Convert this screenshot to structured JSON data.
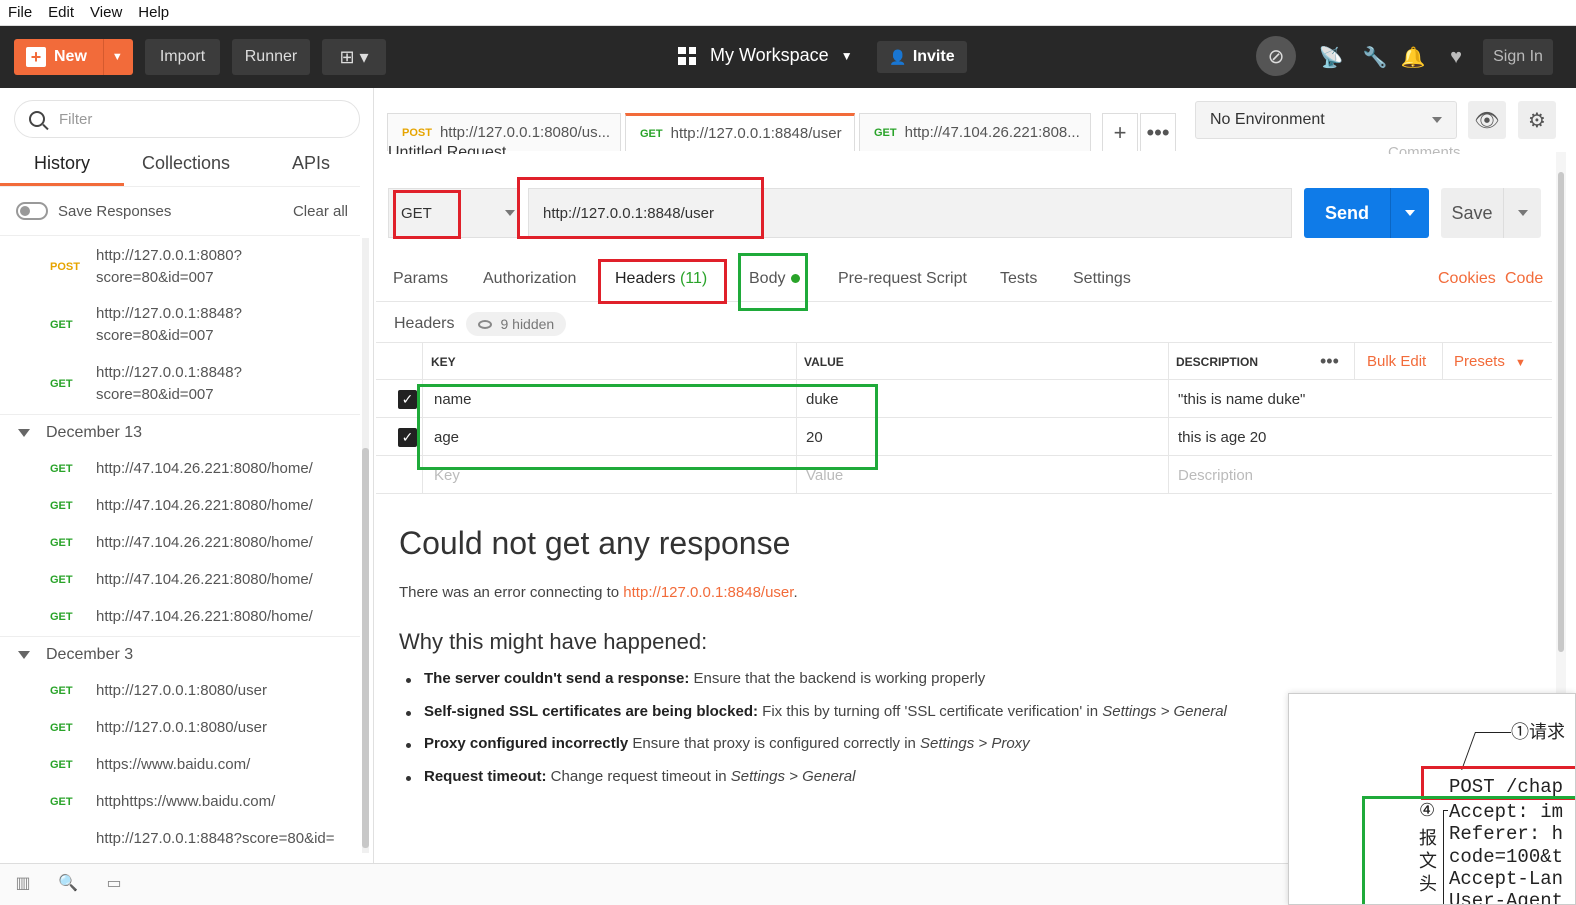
{
  "menu": [
    "File",
    "Edit",
    "View",
    "Help"
  ],
  "toolbar": {
    "new_label": "New",
    "import_label": "Import",
    "runner_label": "Runner",
    "workspace_label": "My Workspace",
    "invite_label": "Invite",
    "signin_label": "Sign In"
  },
  "sidebar": {
    "filter_placeholder": "Filter",
    "tabs": [
      "History",
      "Collections",
      "APIs"
    ],
    "save_responses": "Save Responses",
    "clear_all": "Clear all",
    "items_top": [
      {
        "method": "POST",
        "url": "http://127.0.0.1:8080?score=80&id=007"
      },
      {
        "method": "GET",
        "url": "http://127.0.0.1:8848?score=80&id=007"
      },
      {
        "method": "GET",
        "url": "http://127.0.0.1:8848?score=80&id=007"
      }
    ],
    "group1": "December 13",
    "items_g1": [
      {
        "method": "GET",
        "url": "http://47.104.26.221:8080/home/"
      },
      {
        "method": "GET",
        "url": "http://47.104.26.221:8080/home/"
      },
      {
        "method": "GET",
        "url": "http://47.104.26.221:8080/home/"
      },
      {
        "method": "GET",
        "url": "http://47.104.26.221:8080/home/"
      },
      {
        "method": "GET",
        "url": "http://47.104.26.221:8080/home/"
      }
    ],
    "group2": "December 3",
    "items_g2": [
      {
        "method": "GET",
        "url": "http://127.0.0.1:8080/user"
      },
      {
        "method": "GET",
        "url": "http://127.0.0.1:8080/user"
      },
      {
        "method": "GET",
        "url": "https://www.baidu.com/"
      },
      {
        "method": "GET",
        "url": "httphttps://www.baidu.com/"
      }
    ],
    "item_last": "http://127.0.0.1:8848?score=80&id="
  },
  "tabs": [
    {
      "method": "POST",
      "label": "http://127.0.0.1:8080/us..."
    },
    {
      "method": "GET",
      "label": "http://127.0.0.1:8848/user"
    },
    {
      "method": "GET",
      "label": "http://47.104.26.221:808..."
    }
  ],
  "environment": "No Environment",
  "request": {
    "title": "Untitled Request",
    "comments": "Comments",
    "method": "GET",
    "url": "http://127.0.0.1:8848/user",
    "send_label": "Send",
    "save_label": "Save"
  },
  "subtabs": {
    "params": "Params",
    "authorization": "Authorization",
    "headers": "Headers",
    "headers_count": "(11)",
    "body": "Body",
    "prerequest": "Pre-request Script",
    "tests": "Tests",
    "settings": "Settings",
    "cookies": "Cookies",
    "code": "Code"
  },
  "headers_section": {
    "title": "Headers",
    "hidden": "9 hidden",
    "columns": {
      "key": "KEY",
      "value": "VALUE",
      "description": "DESCRIPTION"
    },
    "bulk_edit": "Bulk Edit",
    "presets": "Presets",
    "rows": [
      {
        "key": "name",
        "value": "duke",
        "description": "\"this is name duke\""
      },
      {
        "key": "age",
        "value": "20",
        "description": "this is age 20"
      }
    ],
    "placeholder": {
      "key": "Key",
      "value": "Value",
      "description": "Description"
    }
  },
  "response": {
    "title": "Could not get any response",
    "error_prefix": "There was an error connecting to ",
    "error_link": "http://127.0.0.1:8848/user",
    "error_suffix": ".",
    "why_title": "Why this might have happened:",
    "reasons": [
      {
        "bold": "The server couldn't send a response:",
        "text": " Ensure that the backend is working properly",
        "it": "",
        "tail": ""
      },
      {
        "bold": "Self-signed SSL certificates are being blocked:",
        "text": " Fix this by turning off 'SSL certificate verification' in ",
        "it": "Settings > General",
        "tail": ""
      },
      {
        "bold": "Proxy configured incorrectly",
        "text": " Ensure that proxy is configured correctly in ",
        "it": "Settings > Proxy",
        "tail": ""
      },
      {
        "bold": "Request timeout:",
        "text": " Change request timeout in ",
        "it": "Settings > General",
        "tail": ""
      }
    ]
  },
  "embed": {
    "label": "①请求",
    "code_lines": [
      "POST /chap",
      "Accept: im",
      "Referer: h",
      "code=100&t",
      "Accept-Lan",
      "User-Agent"
    ],
    "side_chars": [
      "④",
      "报",
      "文",
      "头"
    ]
  },
  "colors": {
    "accent": "#f26b3a",
    "send": "#0f7be8",
    "get": "#29a329",
    "post": "#e6a400",
    "annotation_red": "#e0202a",
    "annotation_green": "#1faa3a"
  }
}
